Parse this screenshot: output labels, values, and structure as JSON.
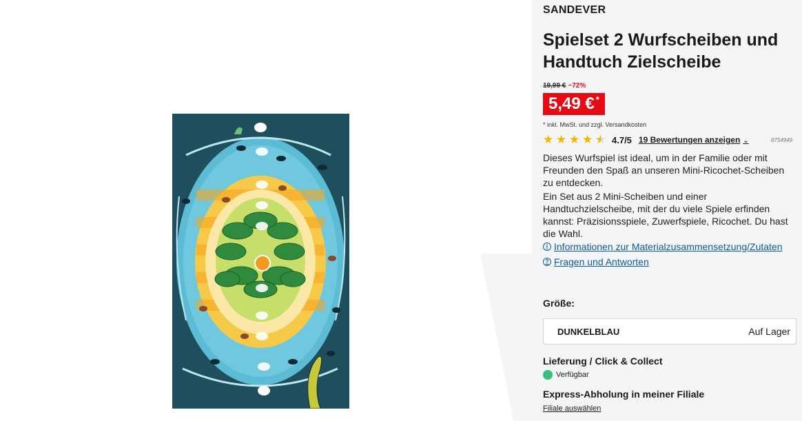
{
  "product": {
    "brand": "SANDEVER",
    "title": "Spielset 2 Wurfscheiben und Handtuch Zielscheibe",
    "image_alt": "Handtuch Zielscheibe mit Insel-Motiv"
  },
  "pricing": {
    "old_price": "19,99 €",
    "discount": "−72%",
    "price": "5,49 €",
    "price_marker": "*",
    "tax_note": "* inkl. MwSt. und zzgl. Versandkosten"
  },
  "rating": {
    "score": 4.5,
    "score_label": "4.7/5",
    "reviews_link": "19 Bewertungen anzeigen",
    "sku": "8754949"
  },
  "description": {
    "paragraph1": "Dieses Wurfspiel ist ideal, um in der Familie oder mit Freunden den Spaß an unseren Mini-Ricochet-Scheiben zu entdecken.",
    "paragraph2": "Ein Set aus 2 Mini-Scheiben und einer Handtuchzielscheibe, mit der du viele Spiele erfinden kannst: Präzisionsspiele, Zuwerfspiele, Ricochet. Du hast die Wahl."
  },
  "links": {
    "material_info": "Informationen zur Materialzusammensetzung/Zutaten",
    "qa": "Fragen und Antworten"
  },
  "size": {
    "label": "Größe:",
    "selected": "DUNKELBLAU",
    "stock": "Auf Lager"
  },
  "delivery": {
    "heading": "Lieferung / Click & Collect",
    "availability": "Verfügbar",
    "express_heading": "Express-Abholung in meiner Filiale",
    "store_link": "Filiale auswählen"
  },
  "colors": {
    "accent_red": "#e60a14",
    "link_blue": "#0d5a9e",
    "available_green": "#3dbd7d",
    "star_yellow": "#f4b400"
  }
}
